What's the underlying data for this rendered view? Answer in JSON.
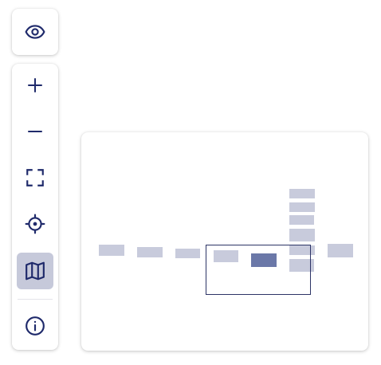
{
  "colors": {
    "icon": "#1f2a6b",
    "active_bg": "#c6c9da",
    "node": "#c8cbdc",
    "node_highlight": "#6b78a8",
    "viewport_border": "#2d3466"
  },
  "toolbar": {
    "top": [
      {
        "name": "toggle-visibility-button",
        "icon": "eye-icon"
      }
    ],
    "tools": [
      {
        "name": "zoom-in-button",
        "icon": "plus-icon"
      },
      {
        "name": "zoom-out-button",
        "icon": "minus-icon"
      },
      {
        "name": "fit-view-button",
        "icon": "fullscreen-corners-icon"
      },
      {
        "name": "center-view-button",
        "icon": "crosshair-icon"
      },
      {
        "name": "minimap-toggle-button",
        "icon": "map-icon",
        "active": true
      },
      {
        "name": "info-button",
        "icon": "info-icon"
      }
    ]
  },
  "minimap": {
    "node_count": 12,
    "highlighted_nodes": 1
  }
}
